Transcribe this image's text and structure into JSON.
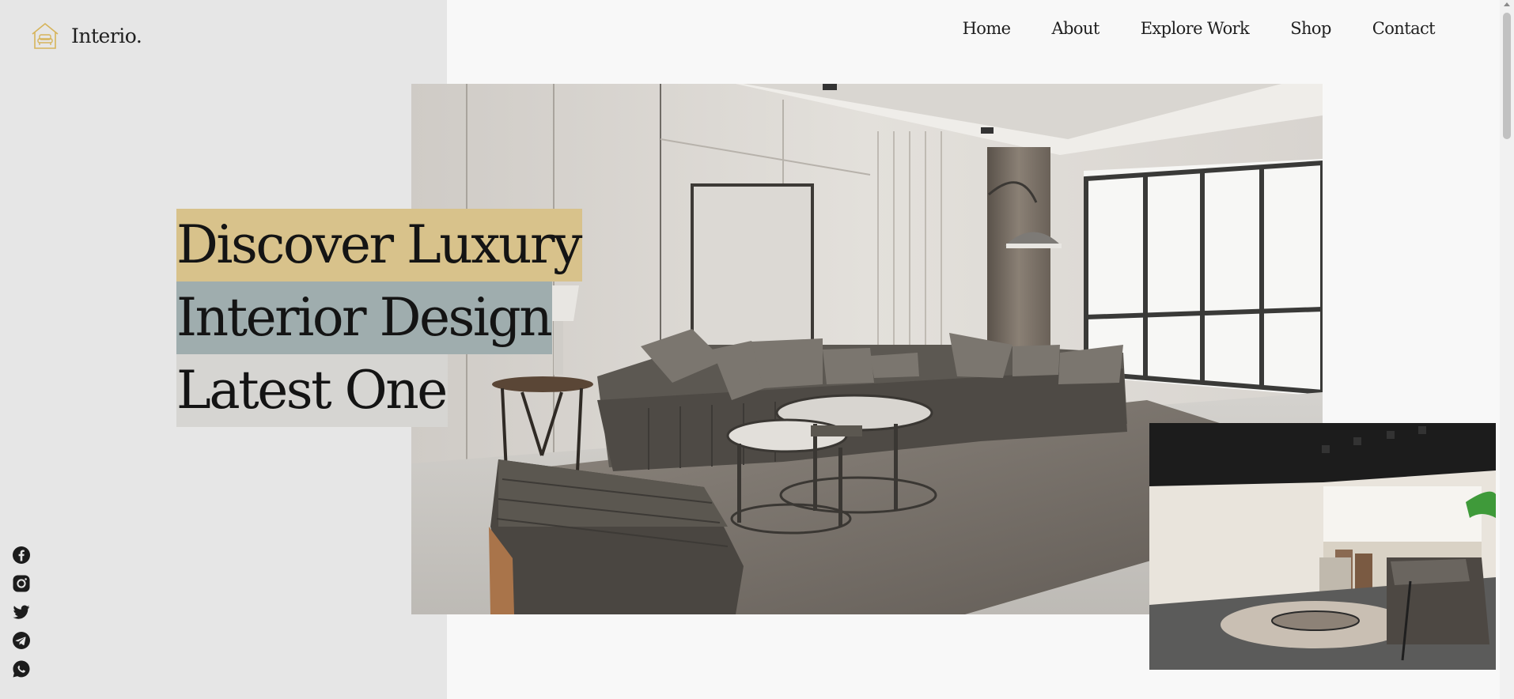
{
  "brand": {
    "name": "Interio.",
    "accent": "#d6b45a"
  },
  "nav": {
    "items": [
      {
        "label": "Home"
      },
      {
        "label": "About"
      },
      {
        "label": "Explore Work"
      },
      {
        "label": "Shop"
      },
      {
        "label": "Contact"
      }
    ]
  },
  "hero": {
    "line1": "Discover Luxury",
    "line2": "Interior Design",
    "line3": "Latest One",
    "colors": {
      "line1_bg": "#d8c28b",
      "line2_bg": "#9fadae",
      "line3_bg": "#d6d5d2",
      "left_panel": "#e6e6e6"
    }
  },
  "social": [
    "facebook-icon",
    "instagram-icon",
    "twitter-icon",
    "telegram-icon",
    "whatsapp-icon"
  ]
}
